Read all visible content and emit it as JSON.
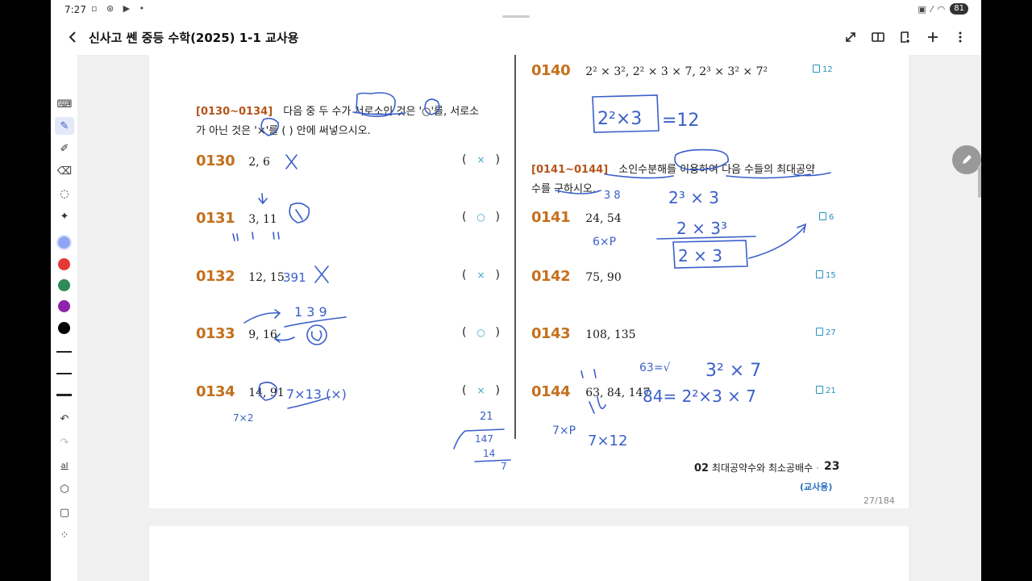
{
  "status": {
    "time": "7:27",
    "battery": "81"
  },
  "header": {
    "title": "신사고 쎈 중등 수학(2025) 1-1 교사용"
  },
  "icons": {
    "back": "chevron-left-icon",
    "expand": "expand-icon",
    "book_view": "book-view-icon",
    "bookmark_add": "bookmark-icon",
    "add": "plus-icon",
    "more": "more-vertical-icon"
  },
  "toolbar_colors": [
    "#8ea6f2",
    "#e53935",
    "#2e8b57",
    "#8e24aa",
    "#000000"
  ],
  "left": {
    "instruction_range": "[0130~0134]",
    "instruction_line1": "다음 중 두 수가 서로소인 것은 '○'를, 서로소",
    "instruction_line2": "가 아닌 것은 '×'를 (    ) 안에 써넣으시오.",
    "questions": [
      {
        "num": "0130",
        "values": "2, 6",
        "answer": "×"
      },
      {
        "num": "0131",
        "values": "3, 11",
        "answer": "○"
      },
      {
        "num": "0132",
        "values": "12, 15",
        "answer": "×"
      },
      {
        "num": "0133",
        "values": "9, 16",
        "answer": "○"
      },
      {
        "num": "0134",
        "values": "14, 91",
        "answer": "×"
      }
    ]
  },
  "right": {
    "q0140": {
      "num": "0140",
      "expr": "2² × 3², 2² × 3 × 7, 2³ × 3² × 7²",
      "ref": "12"
    },
    "instruction_range": "[0141~0144]",
    "instruction_line1": "소인수분해를 이용하여 다음 수들의 최대공약",
    "instruction_line2": "수를 구하시오.",
    "questions": [
      {
        "num": "0141",
        "values": "24, 54",
        "ref": "6"
      },
      {
        "num": "0142",
        "values": "75, 90",
        "ref": "15"
      },
      {
        "num": "0143",
        "values": "108, 135",
        "ref": "27"
      },
      {
        "num": "0144",
        "values": "63, 84, 147",
        "ref": "21"
      }
    ]
  },
  "footer": {
    "chapter_num": "02",
    "chapter_title": "최대공약수와 최소공배수",
    "page_number": "23",
    "edition": "(교사용)",
    "page_count": "27/184"
  }
}
